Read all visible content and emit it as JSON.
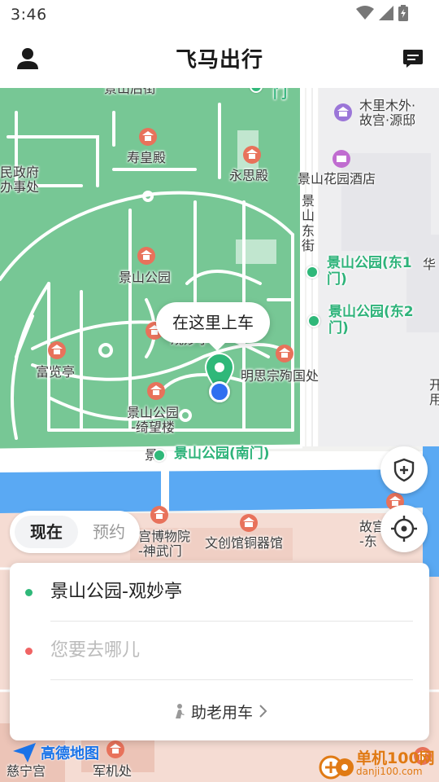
{
  "status_bar": {
    "time": "3:46"
  },
  "header": {
    "title": "飞马出行"
  },
  "map": {
    "labels": {
      "jingshan_top": "景山后街",
      "mulimu": "木里木外·\n故宫·源邸",
      "zhengfu": "民政府\n办事处",
      "shouhuang": "寿皇殿",
      "yongsi": "永思殿",
      "hotel": "景山花园酒店",
      "jingshan_dongjie": "景\n山\n东\n街",
      "park_name": "景山公园",
      "gate_east1": "景山公园(东1\n门)",
      "hua": "华",
      "gate_east2": "景山公园(东2\n门)",
      "guanmiao": "观妙亭",
      "fulan": "富览亭",
      "mingsi": "明思宗殉国处",
      "qiwang": "景山公园\n-绮望楼",
      "kai": "开\n用",
      "south_gate": "景山公园(南门)",
      "jing": "景",
      "shenwu": "宫博物院\n-神武门",
      "wenchuang": "文创馆铜器馆",
      "gugong_east": "故宫\n-东",
      "cining": "慈宁宫",
      "junji": "军机处",
      "top_park": "门"
    },
    "pickup_bubble": "在这里上车",
    "amap_logo": "高德地图"
  },
  "time_tabs": {
    "now": "现在",
    "reserve": "预约"
  },
  "trip": {
    "origin": "景山公园-观妙亭",
    "destination_placeholder": "您要去哪儿",
    "elder_service": "助老用车"
  },
  "watermark": {
    "site": "单机100网",
    "domain": "danji100.com"
  },
  "colors": {
    "park_green": "#77c795",
    "station_green": "#2eb37a",
    "user_blue": "#2f6ff0",
    "water_blue": "#5aa9f3",
    "poi_red": "#e8725b",
    "dest_red": "#f06464"
  }
}
